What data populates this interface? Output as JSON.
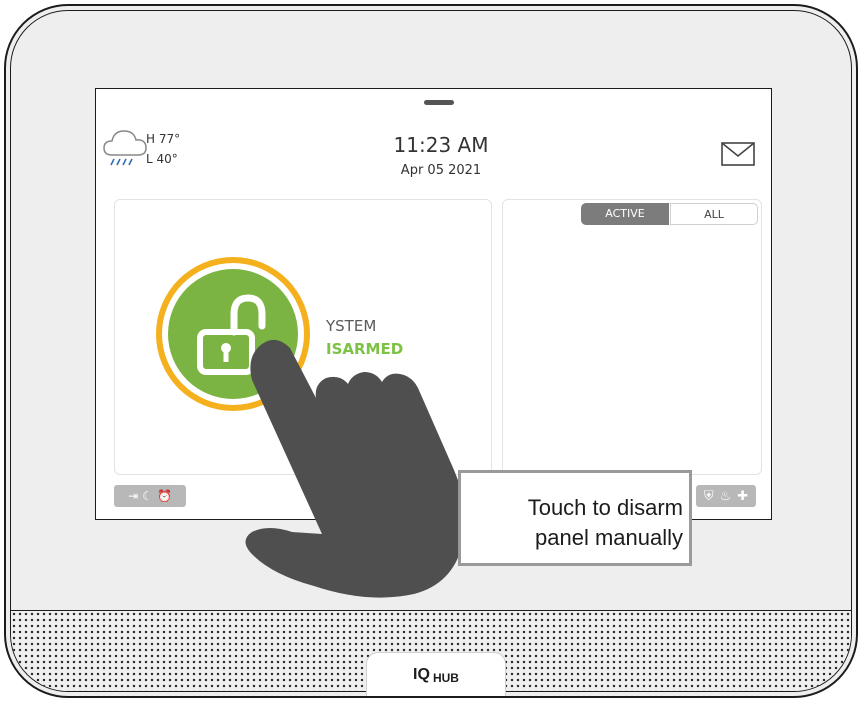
{
  "weather": {
    "high": "H 77°",
    "low": "L 40°",
    "icon": "rain-cloud-icon"
  },
  "clock": {
    "time": "11:23 AM",
    "date": "Apr 05 2021"
  },
  "header": {
    "message_icon": "envelope-icon"
  },
  "events": {
    "tabs": [
      "ACTIVE",
      "ALL"
    ],
    "selected": "ACTIVE"
  },
  "status": {
    "line1": "YSTEM",
    "line2": "ISARMED"
  },
  "arm_button": {
    "state": "disarmed",
    "icon": "unlocked-padlock-icon",
    "ring_color": "#f4b01d",
    "fill_color": "#7cb443"
  },
  "quick_actions": {
    "left_icons": [
      "exit-delay-icon",
      "night-moon-icon",
      "alarm-clock-icon"
    ],
    "right_icons": [
      "police-shield-icon",
      "fire-icon",
      "medical-cross-icon"
    ]
  },
  "callout": {
    "line1": "Touch to disarm",
    "line2": "panel manually"
  },
  "device": {
    "logo_mark": "IQ",
    "logo_text": "HUB"
  },
  "colors": {
    "accent_green": "#7cc243",
    "tab_active": "#7c7c7c",
    "hand": "#4f4f4f"
  }
}
